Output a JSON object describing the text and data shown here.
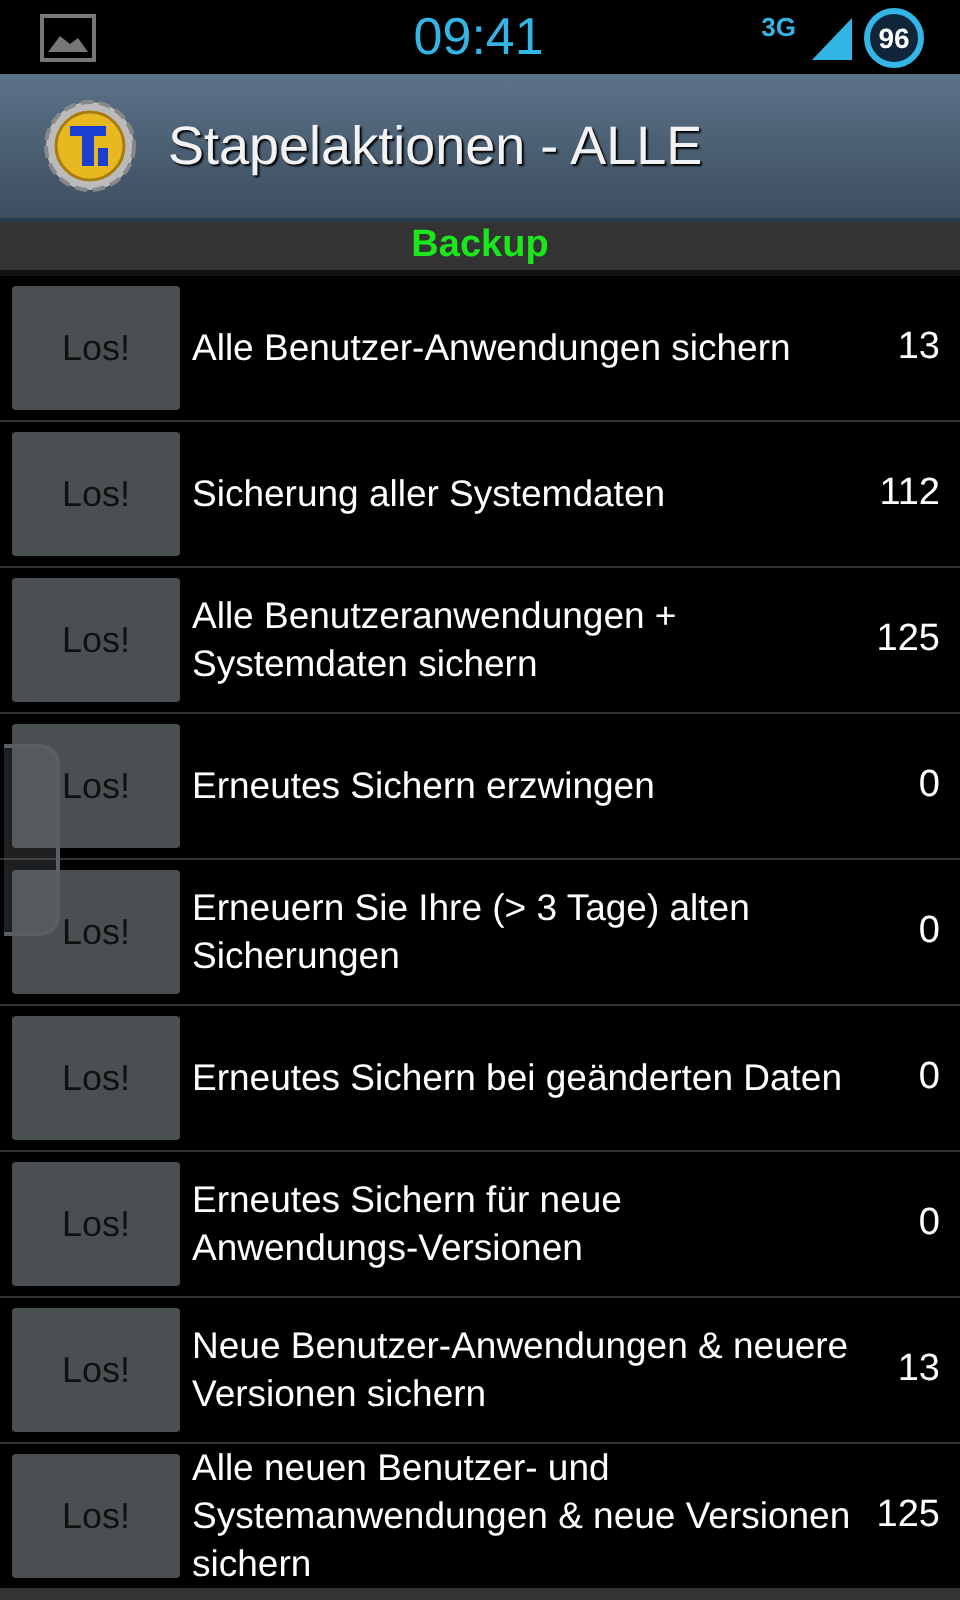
{
  "status_bar": {
    "time": "09:41",
    "network": "3G",
    "battery": "96"
  },
  "action_bar": {
    "title": "Stapelaktionen - ALLE"
  },
  "section": {
    "title": "Backup"
  },
  "actions": [
    {
      "button": "Los!",
      "label": "Alle Benutzer-Anwendungen sichern",
      "count": "13"
    },
    {
      "button": "Los!",
      "label": "Sicherung aller Systemdaten",
      "count": "112"
    },
    {
      "button": "Los!",
      "label": "Alle Benutzeranwendungen + Systemdaten sichern",
      "count": "125"
    },
    {
      "button": "Los!",
      "label": "Erneutes Sichern erzwingen",
      "count": "0"
    },
    {
      "button": "Los!",
      "label": "Erneuern Sie Ihre (> 3 Tage) alten Sicherungen",
      "count": "0"
    },
    {
      "button": "Los!",
      "label": "Erneutes Sichern bei geänderten Daten",
      "count": "0"
    },
    {
      "button": "Los!",
      "label": "Erneutes Sichern für neue Anwendungs-Versionen",
      "count": "0"
    },
    {
      "button": "Los!",
      "label": "Neue Benutzer-Anwendungen & neuere Versionen sichern",
      "count": "13"
    },
    {
      "button": "Los!",
      "label": "Alle neuen Benutzer- und Systemanwendungen & neue Versionen sichern",
      "count": "125"
    }
  ]
}
